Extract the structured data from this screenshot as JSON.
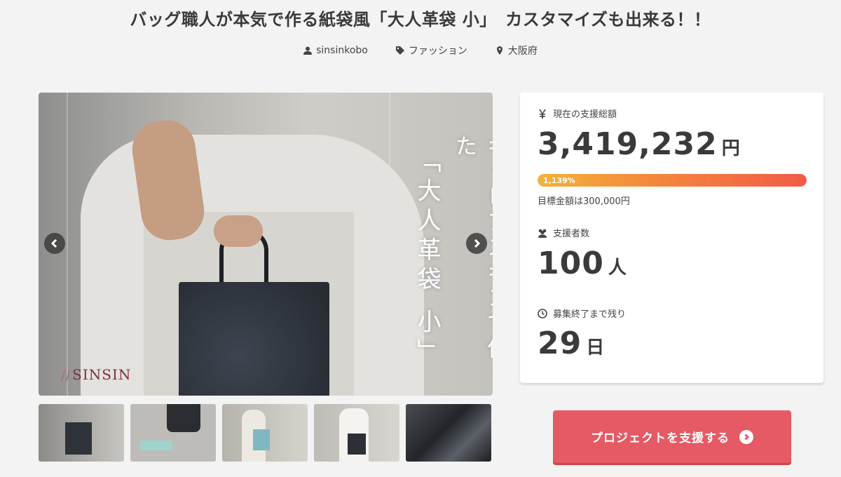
{
  "project": {
    "title": "バッグ職人が本気で作る紙袋風「大人革袋 小」　カスタマイズも出来る！！",
    "owner": "sinsinkobo",
    "category": "ファッション",
    "location": "大阪府"
  },
  "hero": {
    "copy_line1": "キャビアスキンで作った",
    "copy_line2": "「大人革袋 小」",
    "brand": "SINSIN",
    "thumbnail_count": 5
  },
  "stats": {
    "total_label": "現在の支援総額",
    "total_value": "3,419,232",
    "total_unit": "円",
    "progress_percent_label": "1,139%",
    "progress_fraction": 1.0,
    "goal_text": "目標金額は300,000円",
    "supporters_label": "支援者数",
    "supporters_value": "100",
    "supporters_unit": "人",
    "remaining_label": "募集終了まで残り",
    "remaining_value": "29",
    "remaining_unit": "日"
  },
  "cta": {
    "label": "プロジェクトを支援する"
  },
  "colors": {
    "accent": "#e55a64",
    "progress_start": "#f4b23a",
    "progress_end": "#f25a48",
    "brand": "#7e2f3f"
  },
  "icons": {
    "owner": "user-icon",
    "category": "tag-icon",
    "location": "map-pin-icon",
    "total": "yen-icon",
    "supporters": "users-icon",
    "remaining": "clock-icon",
    "cta": "chevron-right-circle-icon"
  }
}
